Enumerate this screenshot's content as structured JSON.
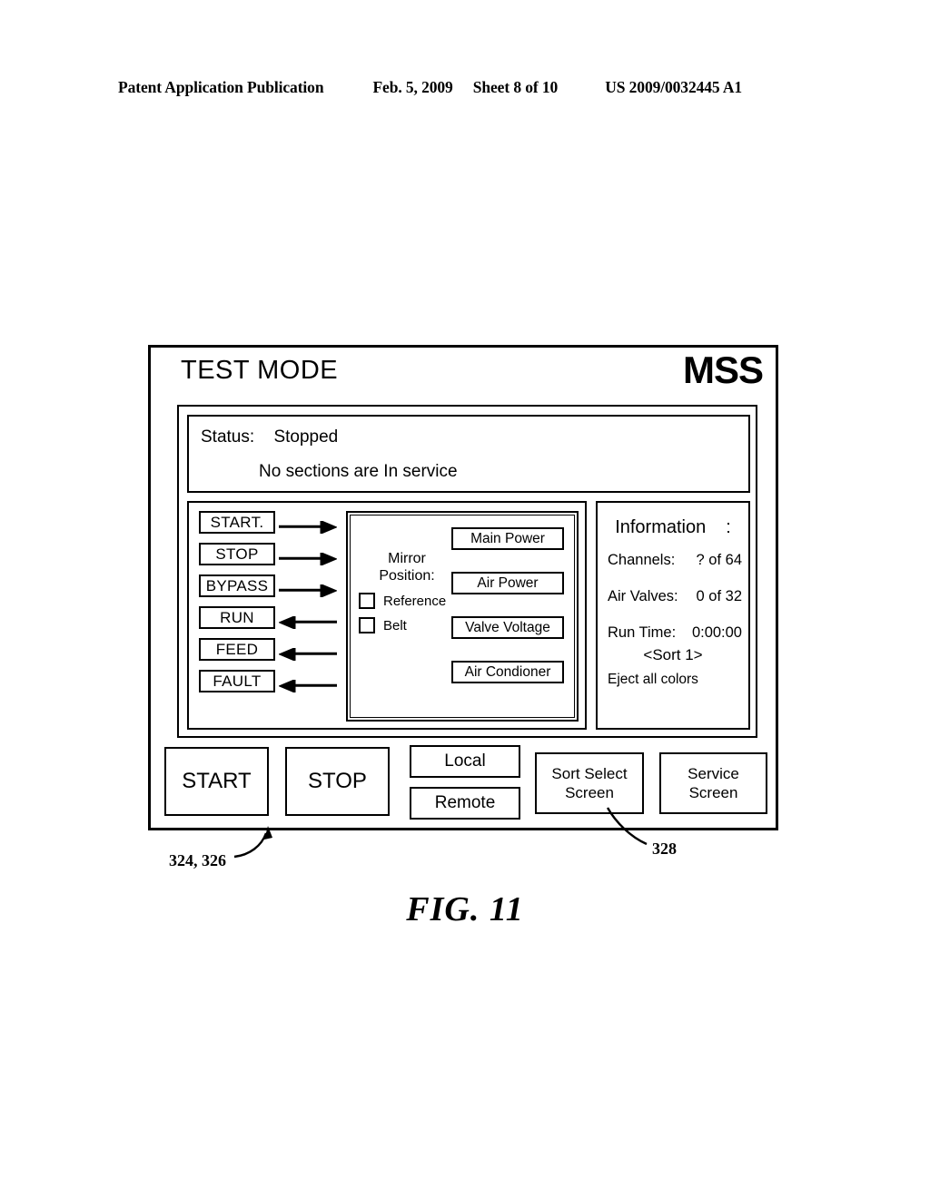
{
  "page_header": {
    "publication": "Patent Application Publication",
    "date": "Feb. 5, 2009",
    "sheet": "Sheet 8 of 10",
    "patent_number": "US 2009/0032445 A1"
  },
  "screen": {
    "mode_title": "TEST MODE",
    "brand": "MSS",
    "status": {
      "label": "Status:",
      "value": "Stopped",
      "message": "No sections are In service"
    },
    "signals": [
      {
        "label": "START.",
        "direction": "right"
      },
      {
        "label": "STOP",
        "direction": "right"
      },
      {
        "label": "BYPASS",
        "direction": "right"
      },
      {
        "label": "RUN",
        "direction": "left"
      },
      {
        "label": "FEED",
        "direction": "left"
      },
      {
        "label": "FAULT",
        "direction": "left"
      }
    ],
    "mirror": {
      "title_line1": "Mirror",
      "title_line2": "Position:",
      "options": [
        {
          "label": "Reference",
          "checked": false
        },
        {
          "label": "Belt",
          "checked": false
        }
      ]
    },
    "power_buttons": [
      "Main Power",
      "Air Power",
      "Valve Voltage",
      "Air Condioner"
    ],
    "information": {
      "title": "Information",
      "colon": ":",
      "rows": [
        {
          "label": "Channels:",
          "value": "? of 64"
        },
        {
          "label": "Air Valves:",
          "value": "0 of 32"
        },
        {
          "label": "Run Time:",
          "value": "0:00:00"
        }
      ],
      "sort": "<Sort 1>",
      "eject": "Eject all colors"
    },
    "actions": {
      "start": "START",
      "stop": "STOP",
      "local": "Local",
      "remote": "Remote",
      "sort_select": "Sort Select\nScreen",
      "service": "Service\nScreen"
    }
  },
  "figure": {
    "ref_324_326": "324, 326",
    "ref_328": "328",
    "caption": "FIG. 11"
  }
}
